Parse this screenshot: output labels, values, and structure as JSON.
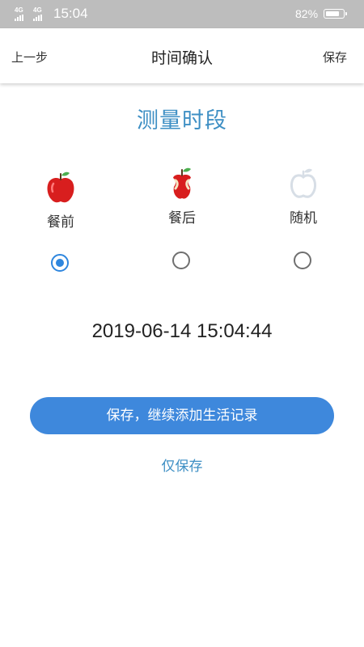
{
  "status_bar": {
    "signal_1": "4G",
    "signal_2": "4G",
    "time": "15:04",
    "battery": "82%",
    "battery_level": 0.82,
    "icons": [
      "signal-icon",
      "battery-icon"
    ]
  },
  "nav": {
    "back_label": "上一步",
    "title": "时间确认",
    "save_label": "保存"
  },
  "section_title": "测量时段",
  "periods": [
    {
      "label": "餐前",
      "icon": "whole-apple-icon",
      "selected": true
    },
    {
      "label": "餐后",
      "icon": "apple-core-icon",
      "selected": false
    },
    {
      "label": "随机",
      "icon": "apple-outline-icon",
      "selected": false
    }
  ],
  "datetime": "2019-06-14 15:04:44",
  "actions": {
    "save_continue_label": "保存，继续添加生活记录",
    "save_only_label": "仅保存"
  },
  "colors": {
    "accent": "#3e88dc",
    "title_blue": "#3e8fc4",
    "apple_red": "#d81e1e",
    "leaf_green": "#4caf50",
    "status_bar": "#bdbdbd"
  }
}
